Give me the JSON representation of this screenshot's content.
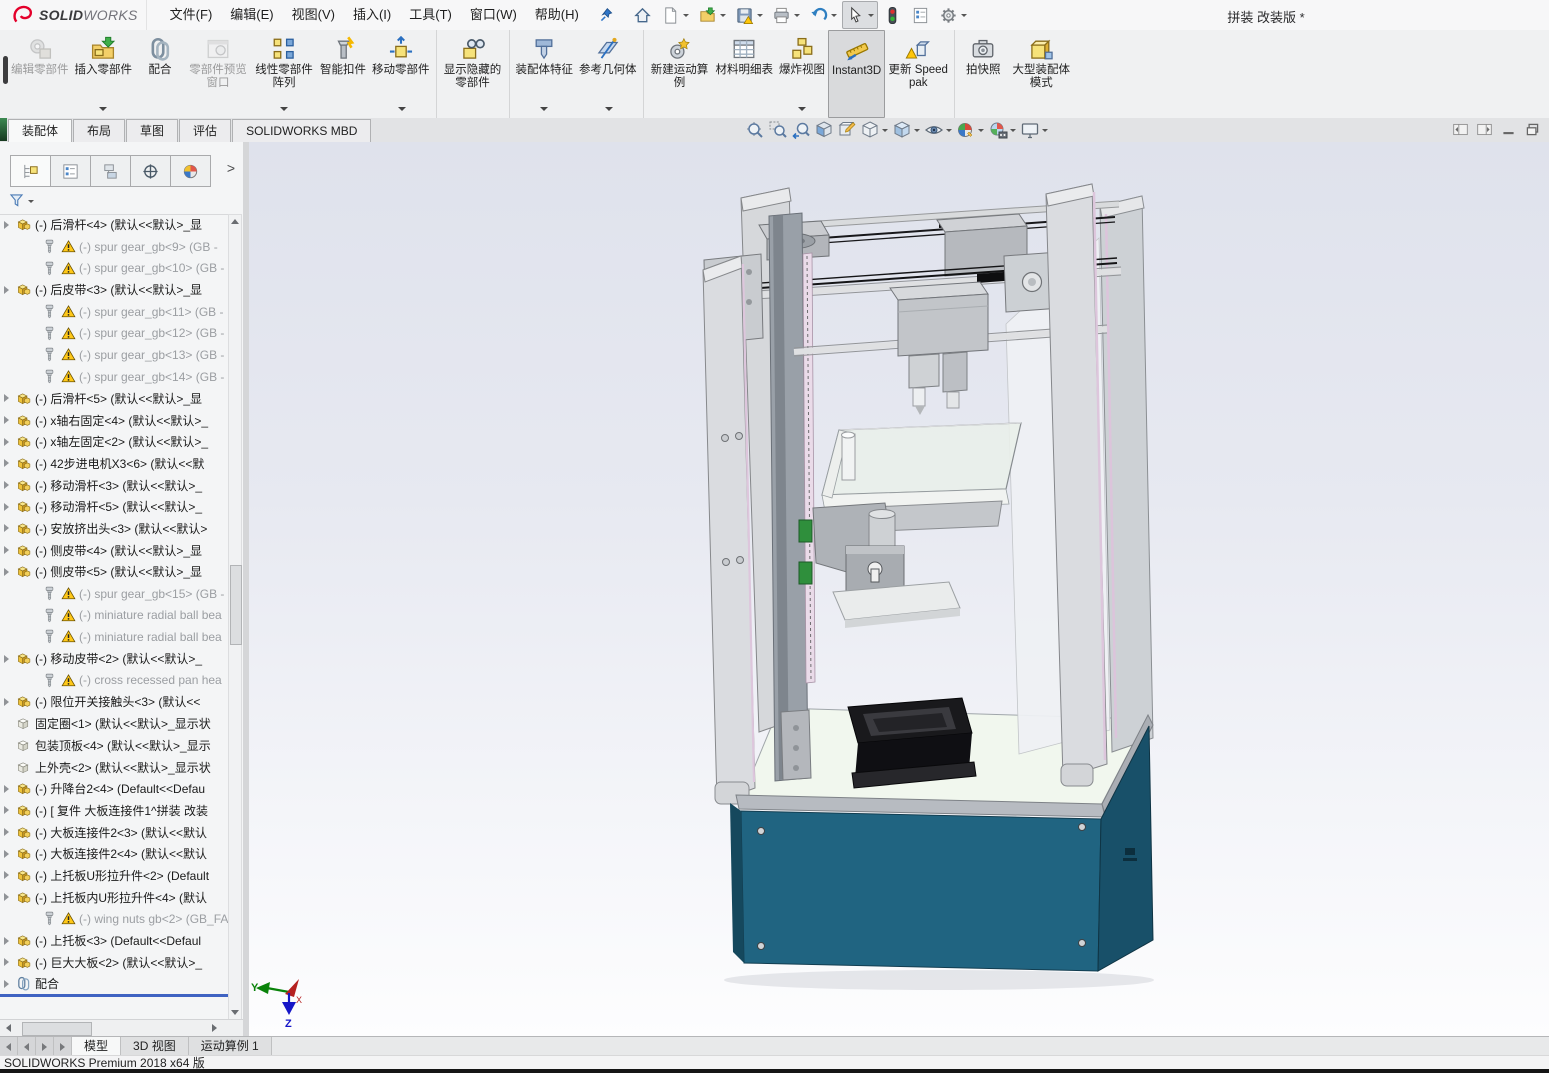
{
  "window": {
    "title": "拼装 改装版 *",
    "logo_solid": "SOLID",
    "logo_works": "WORKS"
  },
  "colors": {
    "accent_blue": "#3f63c2",
    "base_teal": "#206481",
    "warn_yellow": "#ffc818",
    "logo_red": "#e4002b"
  },
  "menubar": {
    "items": [
      {
        "label": "文件(F)"
      },
      {
        "label": "编辑(E)"
      },
      {
        "label": "视图(V)"
      },
      {
        "label": "插入(I)"
      },
      {
        "label": "工具(T)"
      },
      {
        "label": "窗口(W)"
      },
      {
        "label": "帮助(H)"
      }
    ]
  },
  "quick_toolbar": {
    "items": [
      {
        "name": "home-button",
        "icon": "q-home",
        "cls": ""
      },
      {
        "name": "new-document-button",
        "icon": "q-new",
        "cls": "caret"
      },
      {
        "name": "open-button",
        "icon": "q-open",
        "cls": "caret"
      },
      {
        "name": "save-button",
        "icon": "q-save",
        "cls": "caret"
      },
      {
        "name": "print-button",
        "icon": "q-print",
        "cls": "caret"
      },
      {
        "name": "undo-button",
        "icon": "q-undo",
        "cls": "caret"
      },
      {
        "name": "select-button",
        "icon": "q-select",
        "cls": "caret active"
      },
      {
        "name": "rebuild-button",
        "icon": "q-rebuild",
        "cls": ""
      },
      {
        "name": "file-properties-button",
        "icon": "q-fprops",
        "cls": ""
      },
      {
        "name": "options-button",
        "icon": "q-options",
        "cls": "caret"
      }
    ]
  },
  "commandmanager": {
    "buttons": [
      {
        "label": "编辑零部件",
        "icon": "cm-edit",
        "cls": "disabled"
      },
      {
        "label": "插入零部件",
        "icon": "cm-insert",
        "cls": "caret"
      },
      {
        "label": "配合",
        "icon": "cm-mate",
        "cls": ""
      },
      {
        "label": "零部件预览窗口",
        "icon": "cm-preview",
        "cls": "disabled"
      },
      {
        "label": "线性零部件阵列",
        "icon": "cm-linear",
        "cls": "caret"
      },
      {
        "label": "智能扣件",
        "icon": "cm-smart",
        "cls": ""
      },
      {
        "label": "移动零部件",
        "icon": "cm-move",
        "cls": "caret gend"
      },
      {
        "label": "显示隐藏的零部件",
        "icon": "cm-showhidden",
        "cls": "gend"
      },
      {
        "label": "装配体特征",
        "icon": "cm-asmfeat",
        "cls": "caret"
      },
      {
        "label": "参考几何体",
        "icon": "cm-refgeo",
        "cls": "caret gend"
      },
      {
        "label": "新建运动算例",
        "icon": "cm-motion",
        "cls": ""
      },
      {
        "label": "材料明细表",
        "icon": "cm-bom",
        "cls": ""
      },
      {
        "label": "爆炸视图",
        "icon": "cm-explode",
        "cls": "caret"
      },
      {
        "label": "Instant3D",
        "icon": "cm-instant3d",
        "cls": "active"
      },
      {
        "label": "更新 Speedpak",
        "icon": "cm-speedpak",
        "cls": "gend"
      },
      {
        "label": "拍快照",
        "icon": "cm-snapshot",
        "cls": ""
      },
      {
        "label": "大型装配体模式",
        "icon": "cm-large",
        "cls": ""
      }
    ]
  },
  "cm_tabs": {
    "items": [
      {
        "label": "装配体",
        "cls": "active"
      },
      {
        "label": "布局",
        "cls": ""
      },
      {
        "label": "草图",
        "cls": ""
      },
      {
        "label": "评估",
        "cls": ""
      },
      {
        "label": "SOLIDWORKS MBD",
        "cls": ""
      }
    ]
  },
  "headsup": {
    "items": [
      {
        "name": "zoom-to-fit-button",
        "icon": "hu-zoomfit",
        "cls": ""
      },
      {
        "name": "zoom-to-area-button",
        "icon": "hu-zoomarea",
        "cls": ""
      },
      {
        "name": "previous-view-button",
        "icon": "hu-prev",
        "cls": ""
      },
      {
        "name": "section-view-button",
        "icon": "hu-section",
        "cls": ""
      },
      {
        "name": "annotation-view-button",
        "icon": "hu-annot",
        "cls": ""
      },
      {
        "name": "view-orientation-button",
        "icon": "hu-orient",
        "cls": "caret"
      },
      {
        "name": "display-style-button",
        "icon": "hu-display",
        "cls": "caret"
      },
      {
        "name": "hide-show-items-button",
        "icon": "hu-hide",
        "cls": "caret"
      },
      {
        "name": "edit-appearance-button",
        "icon": "hu-appearance",
        "cls": "caret"
      },
      {
        "name": "apply-scene-button",
        "icon": "hu-scene",
        "cls": "caret"
      },
      {
        "name": "view-settings-button",
        "icon": "hu-viewset",
        "cls": "caret"
      }
    ]
  },
  "pane_buttons": {
    "items": [
      {
        "name": "collapse-left-pane-button",
        "icon": "w-pane-l"
      },
      {
        "name": "collapse-right-pane-button",
        "icon": "w-pane-r"
      },
      {
        "name": "minimize-document-button",
        "icon": "w-min"
      },
      {
        "name": "restore-document-button",
        "icon": "w-restore"
      }
    ]
  },
  "featurepanel": {
    "overflow": ">",
    "tabs": [
      {
        "name": "featuremanager-tree-tab",
        "icon": "pt-feat",
        "cls": "active"
      },
      {
        "name": "propertymanager-tab",
        "icon": "pt-prop",
        "cls": ""
      },
      {
        "name": "configurationmanager-tab",
        "icon": "pt-config",
        "cls": ""
      },
      {
        "name": "dimxpertmanager-tab",
        "icon": "pt-dim",
        "cls": ""
      },
      {
        "name": "displaymanager-tab",
        "icon": "pt-disp",
        "cls": ""
      }
    ],
    "items": [
      {
        "cls": "asm arrow",
        "label": "(-) 后滑杆<4> (默认<<默认>_显"
      },
      {
        "cls": "screw warn dim",
        "label": "(-) spur gear_gb<9> (GB -"
      },
      {
        "cls": "screw warn dim",
        "label": "(-) spur gear_gb<10> (GB -"
      },
      {
        "cls": "asm arrow",
        "label": "(-) 后皮带<3> (默认<<默认>_显"
      },
      {
        "cls": "screw warn dim",
        "label": "(-) spur gear_gb<11> (GB -"
      },
      {
        "cls": "screw warn dim",
        "label": "(-) spur gear_gb<12> (GB -"
      },
      {
        "cls": "screw warn dim",
        "label": "(-) spur gear_gb<13> (GB -"
      },
      {
        "cls": "screw warn dim",
        "label": "(-) spur gear_gb<14> (GB -"
      },
      {
        "cls": "asm arrow",
        "label": "(-) 后滑杆<5> (默认<<默认>_显"
      },
      {
        "cls": "asm arrow",
        "label": "(-) x轴右固定<4> (默认<<默认>_"
      },
      {
        "cls": "asm arrow",
        "label": "(-) x轴左固定<2> (默认<<默认>_"
      },
      {
        "cls": "asm arrow",
        "label": "(-) 42步进电机X3<6> (默认<<默"
      },
      {
        "cls": "asm arrow",
        "label": "(-) 移动滑杆<3> (默认<<默认>_"
      },
      {
        "cls": "asm arrow",
        "label": "(-) 移动滑杆<5> (默认<<默认>_"
      },
      {
        "cls": "asm arrow",
        "label": "(-) 安放挤出头<3> (默认<<默认>"
      },
      {
        "cls": "asm arrow",
        "label": "(-) 侧皮带<4> (默认<<默认>_显"
      },
      {
        "cls": "asm arrow",
        "label": "(-) 侧皮带<5> (默认<<默认>_显"
      },
      {
        "cls": "screw warn dim",
        "label": "(-) spur gear_gb<15> (GB -"
      },
      {
        "cls": "screw warn dim",
        "label": "(-) miniature radial ball bea"
      },
      {
        "cls": "screw warn dim",
        "label": "(-) miniature radial ball bea"
      },
      {
        "cls": "asm arrow",
        "label": "(-) 移动皮带<2> (默认<<默认>_"
      },
      {
        "cls": "screw warn dim",
        "label": "(-) cross recessed pan hea"
      },
      {
        "cls": "asm arrow",
        "label": "(-) 限位开关接触头<3> (默认<<"
      },
      {
        "cls": "part",
        "label": "固定圈<1> (默认<<默认>_显示状"
      },
      {
        "cls": "part",
        "label": "包装顶板<4> (默认<<默认>_显示"
      },
      {
        "cls": "part",
        "label": "上外壳<2> (默认<<默认>_显示状"
      },
      {
        "cls": "asm arrow",
        "label": "(-) 升降台2<4> (Default<<Defau"
      },
      {
        "cls": "asm arrow",
        "label": "(-) [ 复件 大板连接件1^拼装 改装"
      },
      {
        "cls": "asm arrow",
        "label": "(-) 大板连接件2<3> (默认<<默认"
      },
      {
        "cls": "asm arrow",
        "label": "(-) 大板连接件2<4> (默认<<默认"
      },
      {
        "cls": "asm arrow",
        "label": "(-) 上托板U形拉升件<2> (Default"
      },
      {
        "cls": "asm arrow",
        "label": "(-) 上托板内U形拉升件<4> (默认"
      },
      {
        "cls": "screw warn dim",
        "label": "(-) wing nuts gb<2> (GB_FA"
      },
      {
        "cls": "asm arrow",
        "label": "(-) 上托板<3> (Default<<Defaul"
      },
      {
        "cls": "asm arrow",
        "label": "(-) 巨大大板<2> (默认<<默认>_"
      },
      {
        "cls": "mates arrow",
        "label": "配合"
      }
    ]
  },
  "triad": {
    "x": "X",
    "y": "Y",
    "z": "Z"
  },
  "doc_tabs": {
    "nav": [
      {
        "name": "first-tab-button",
        "cls": "nav-l"
      },
      {
        "name": "previous-tab-button",
        "cls": "nav-l"
      },
      {
        "name": "next-tab-button",
        "cls": "nav-r"
      },
      {
        "name": "last-tab-button",
        "cls": "nav-r"
      }
    ],
    "items": [
      {
        "label": "模型",
        "cls": "active"
      },
      {
        "label": "3D 视图",
        "cls": ""
      },
      {
        "label": "运动算例 1",
        "cls": ""
      }
    ]
  },
  "statusbar": {
    "text": "SOLIDWORKS Premium 2018 x64 版"
  }
}
